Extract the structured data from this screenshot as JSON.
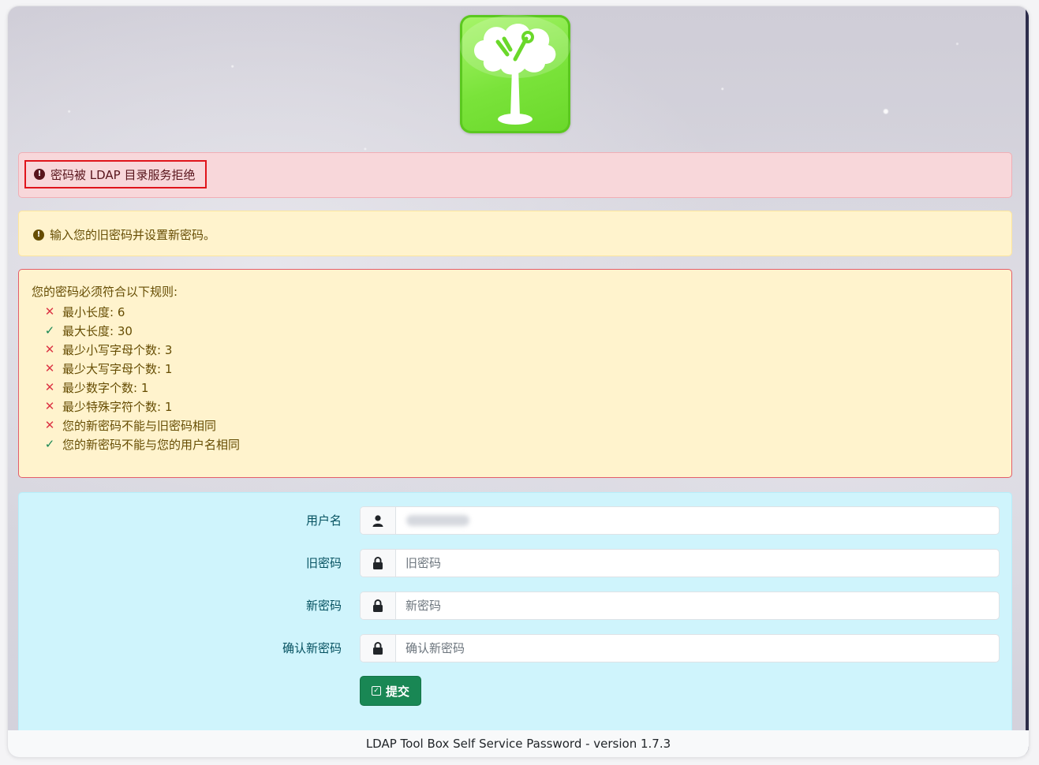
{
  "app": {
    "footer_text": "LDAP Tool Box Self Service Password - version 1.7.3",
    "logo_icon": "tree-tools-logo-icon"
  },
  "alerts": {
    "error": "密码被 LDAP 目录服务拒绝",
    "info": "输入您的旧密码并设置新密码。"
  },
  "rules": {
    "title": "您的密码必须符合以下规则:",
    "items": [
      {
        "text": "最小长度:  6",
        "status": "fail"
      },
      {
        "text": "最大长度:  30",
        "status": "pass"
      },
      {
        "text": "最少小写字母个数:  3",
        "status": "fail"
      },
      {
        "text": "最少大写字母个数:  1",
        "status": "fail"
      },
      {
        "text": "最少数字个数:  1",
        "status": "fail"
      },
      {
        "text": "最少特殊字符个数:  1",
        "status": "fail"
      },
      {
        "text": "您的新密码不能与旧密码相同",
        "status": "fail"
      },
      {
        "text": "您的新密码不能与您的用户名相同",
        "status": "pass"
      }
    ],
    "fail_symbol": "✕",
    "pass_symbol": "✓"
  },
  "form": {
    "username": {
      "label": "用户名",
      "icon": "user-icon"
    },
    "old_password": {
      "label": "旧密码",
      "placeholder": "旧密码",
      "icon": "lock-icon"
    },
    "new_password": {
      "label": "新密码",
      "placeholder": "新密码",
      "icon": "lock-icon"
    },
    "confirm_password": {
      "label": "确认新密码",
      "placeholder": "确认新密码",
      "icon": "lock-icon"
    },
    "submit_label": "提交"
  },
  "colors": {
    "danger_bg": "#f8d7da",
    "warning_bg": "#fff3cd",
    "info_bg": "#cff4fc",
    "success": "#198754",
    "fail": "#dc3545",
    "highlight_border": "#e0141b"
  }
}
